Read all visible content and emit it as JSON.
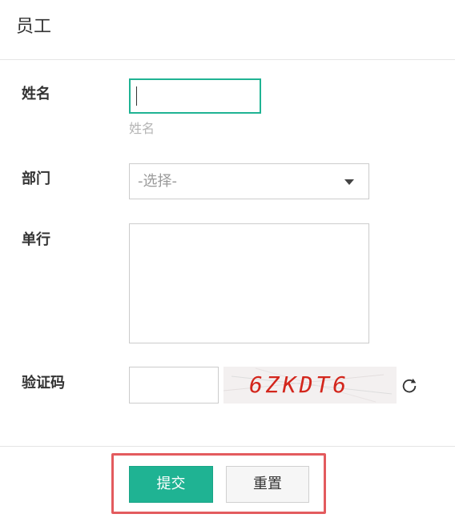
{
  "header": {
    "title": "员工"
  },
  "form": {
    "name": {
      "label": "姓名",
      "value": "",
      "hint": "姓名"
    },
    "department": {
      "label": "部门",
      "selected": "-选择-"
    },
    "unit": {
      "label": "单行",
      "value": ""
    },
    "captcha": {
      "label": "验证码",
      "value": "",
      "image_text": "6ZKDT6",
      "refresh_icon": "refresh-icon"
    }
  },
  "actions": {
    "submit": "提交",
    "reset": "重置"
  },
  "colors": {
    "accent": "#1fb393",
    "highlight": "#e35b5e",
    "captcha_text": "#d3261c"
  }
}
